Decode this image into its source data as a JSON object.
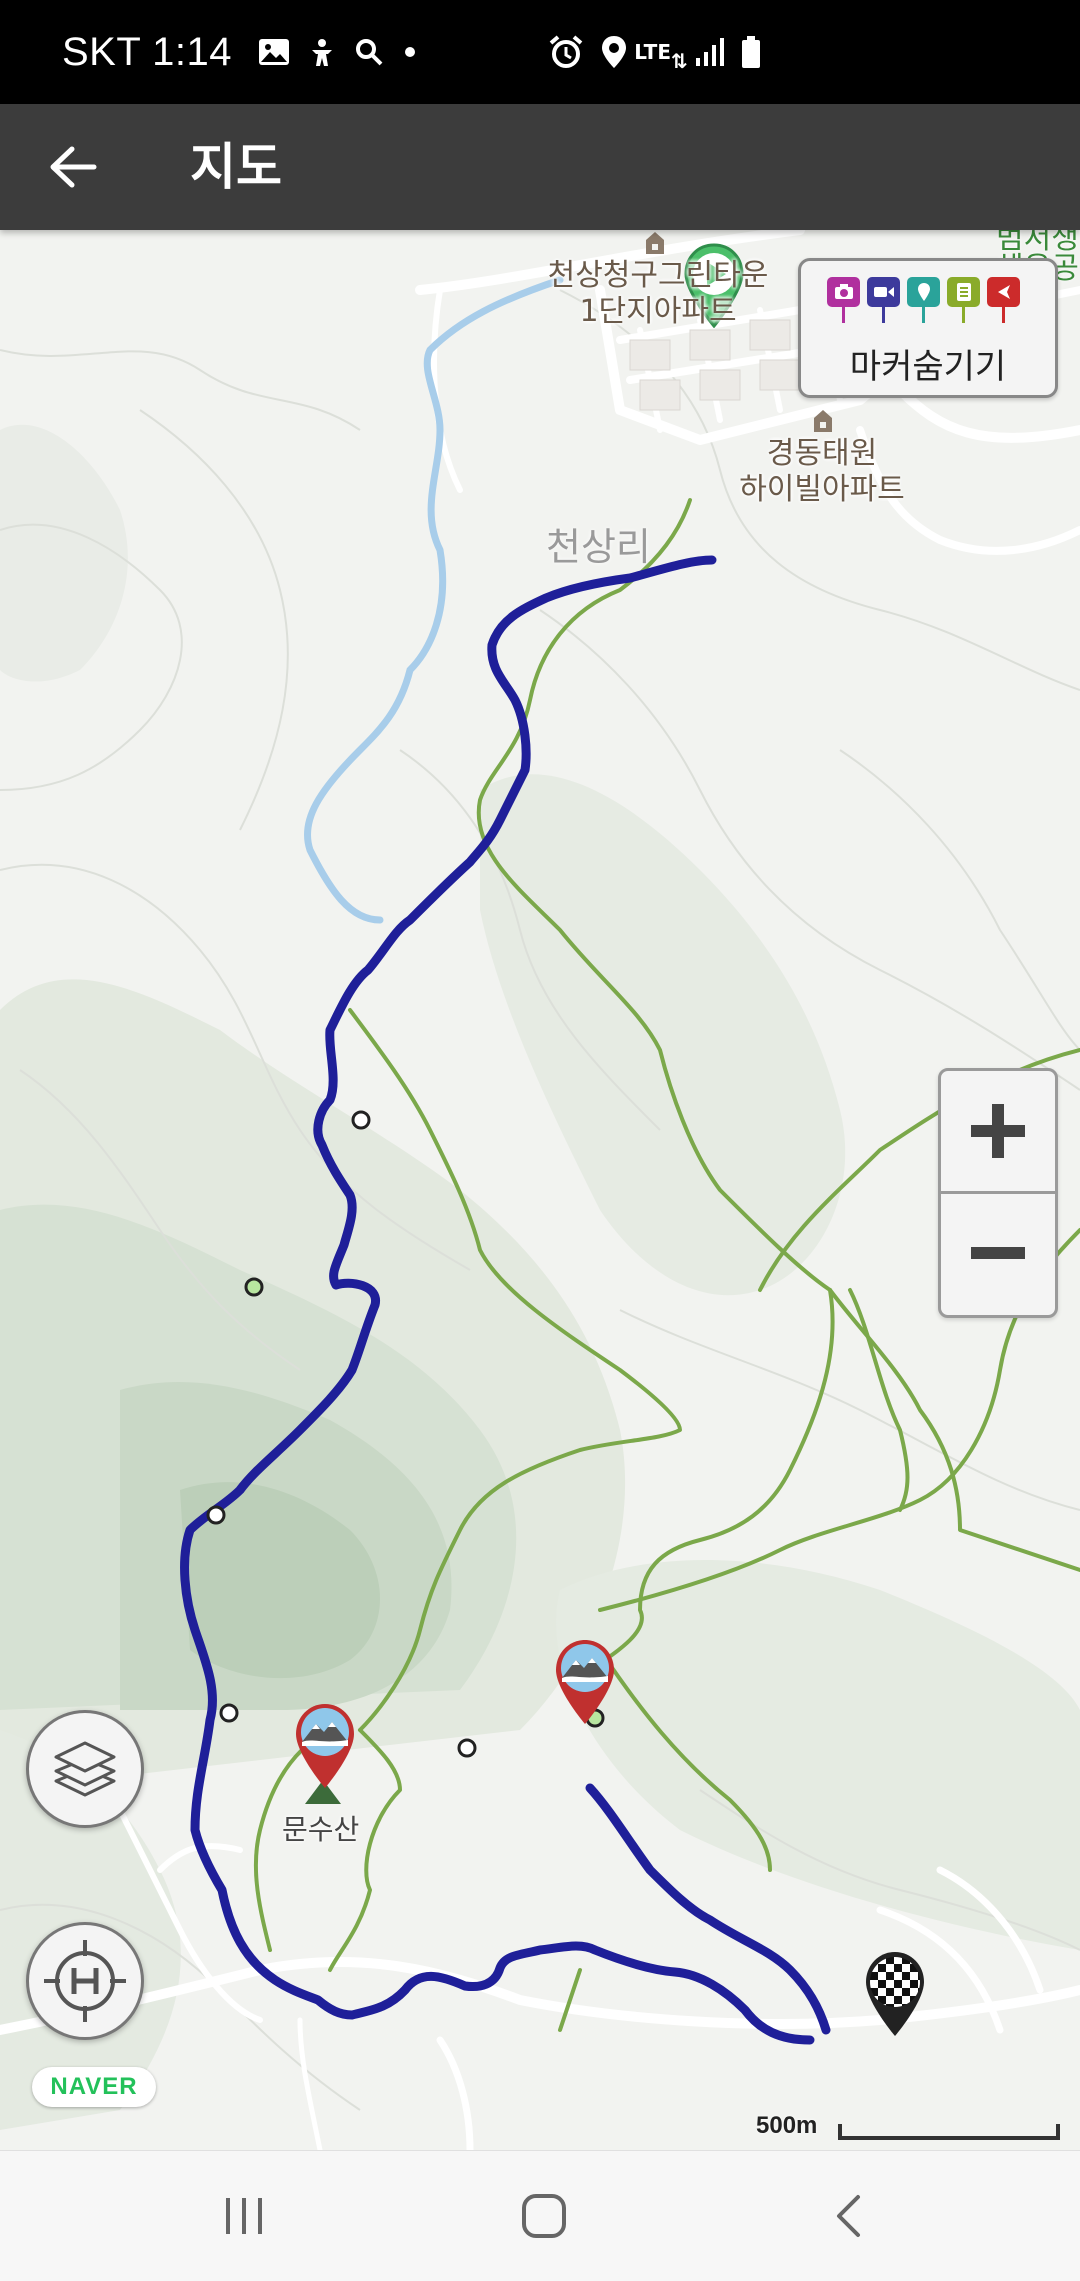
{
  "status_bar": {
    "carrier_time": "SKT 1:14",
    "network": "LTE",
    "icons_left": [
      "gallery-icon",
      "accessibility-icon",
      "search-icon",
      "dot-icon"
    ],
    "icons_right": [
      "alarm-icon",
      "location-icon",
      "lte-icon",
      "signal-icon",
      "battery-icon"
    ]
  },
  "app_bar": {
    "title": "지도",
    "back_icon": "arrow-left-icon"
  },
  "map": {
    "place_labels": {
      "apartment_1": "천상청구그린타운\n1단지아파트",
      "apartment_2": "경동태원\n하이빌아파트",
      "village": "천상리",
      "park": "범서생\n체육공",
      "peak": "문수산"
    },
    "marker_toggle": {
      "label": "마커숨기기",
      "icons": [
        {
          "name": "camera-marker-icon",
          "color": "#b0309e"
        },
        {
          "name": "video-marker-icon",
          "color": "#3d3a9c"
        },
        {
          "name": "pin-marker-icon",
          "color": "#2aa39a"
        },
        {
          "name": "memo-marker-icon",
          "color": "#8aab2a"
        },
        {
          "name": "flag-marker-icon",
          "color": "#cc2b2b"
        }
      ]
    },
    "zoom": {
      "in_label": "+",
      "out_label": "−"
    },
    "scale_label": "500m",
    "provider_logo": "NAVER",
    "route_color": "#1f1f99",
    "trail_color": "#7ba84a"
  }
}
